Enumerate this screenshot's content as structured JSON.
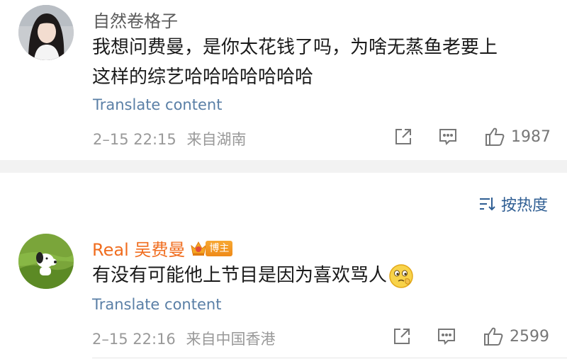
{
  "comments": [
    {
      "username": "自然卷格子",
      "text_lines": [
        "我想问费曼，是你太花钱了吗，为啥无蒸鱼老要上",
        "这样的综艺哈哈哈哈哈哈哈"
      ],
      "translate_label": "Translate content",
      "timestamp": "2–15 22:15",
      "location": "来自湖南",
      "likes": "1987"
    },
    {
      "username": "Real 吴费曼",
      "badge": "博主",
      "text": "有没有可能他上节目是因为喜欢骂人",
      "translate_label": "Translate content",
      "timestamp": "2–15 22:16",
      "location": "来自中国香港",
      "likes": "2599"
    }
  ],
  "sort": {
    "label": "按热度"
  },
  "colors": {
    "link_blue": "#5a7fa6",
    "username_orange": "#f06d1f",
    "meta_gray": "#999999",
    "section_bg": "#f2f2f2"
  },
  "icons": [
    "share-icon",
    "comment-icon",
    "like-icon",
    "sort-icon",
    "verified-crown-icon",
    "emoji-icon"
  ]
}
